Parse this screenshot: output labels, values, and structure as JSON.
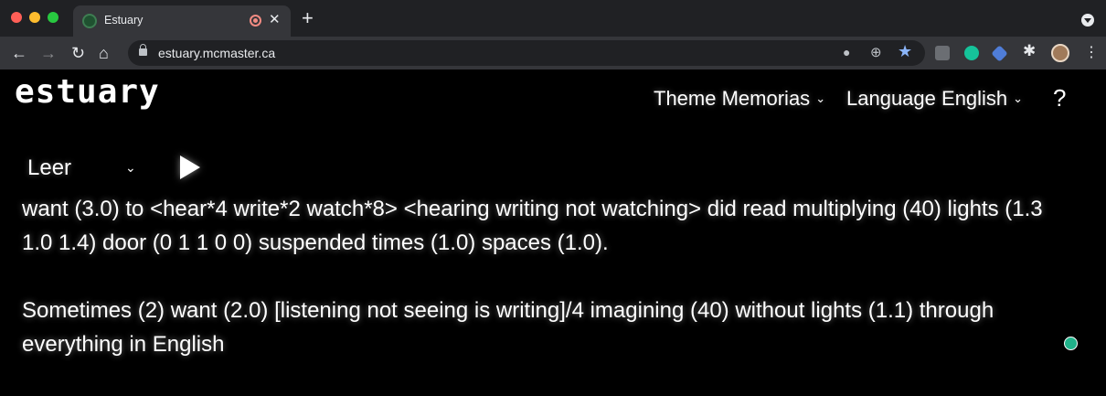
{
  "browser": {
    "tab_title": "Estuary",
    "url": "estuary.mcmaster.ca",
    "new_tab_label": "+",
    "tab_close_label": "✕"
  },
  "site": {
    "logo_text": "estuary",
    "theme_label": "Theme",
    "theme_value": "Memorias",
    "language_label": "Language",
    "language_value": "English",
    "help_label": "?"
  },
  "controls": {
    "mode_value": "Leer"
  },
  "content": {
    "paragraph_1": "want (3.0) to <hear*4 write*2 watch*8> <hearing writing not watching> did read multiplying (40) lights (1.3 1.0 1.4) door (0 1 1 0 0) suspended times (1.0) spaces (1.0).",
    "paragraph_2": "Sometimes (2) want (2.0) [listening not seeing is writing]/4 imagining (40) without lights (1.1) through everything in English"
  },
  "colors": {
    "background": "#000000",
    "text": "#ffffff",
    "status_dot": "#20b28a"
  }
}
